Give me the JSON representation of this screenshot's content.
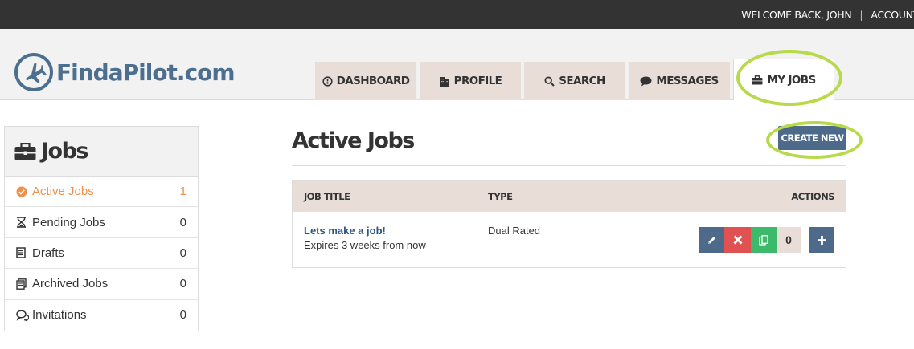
{
  "topbar": {
    "welcome": "WELCOME BACK, JOHN",
    "separator": "|",
    "account": "ACCOUNT"
  },
  "logo": {
    "text": "FindaPilot.com",
    "icon": "airplane-icon",
    "color": "#4d6f8f"
  },
  "nav": {
    "tabs": [
      {
        "label": "DASHBOARD",
        "icon": "dashboard-icon"
      },
      {
        "label": "PROFILE",
        "icon": "building-icon"
      },
      {
        "label": "SEARCH",
        "icon": "search-icon"
      },
      {
        "label": "MESSAGES",
        "icon": "chat-icon"
      },
      {
        "label": "MY JOBS",
        "icon": "briefcase-icon",
        "active": true
      }
    ]
  },
  "sidebar": {
    "title": "Jobs",
    "title_icon": "briefcase-icon",
    "items": [
      {
        "label": "Active Jobs",
        "count": "1",
        "icon": "check-circle-icon",
        "active": true
      },
      {
        "label": "Pending Jobs",
        "count": "0",
        "icon": "hourglass-icon"
      },
      {
        "label": "Drafts",
        "count": "0",
        "icon": "document-icon"
      },
      {
        "label": "Archived Jobs",
        "count": "0",
        "icon": "archive-icon"
      },
      {
        "label": "Invitations",
        "count": "0",
        "icon": "comments-icon"
      }
    ]
  },
  "main": {
    "title": "Active Jobs",
    "create_button": "CREATE NEW",
    "table": {
      "headers": {
        "title": "JOB TITLE",
        "type": "TYPE",
        "actions": "ACTIONS"
      },
      "rows": [
        {
          "title": "Lets make a job!",
          "expires": "Expires 3 weeks from now",
          "type": "Dual Rated",
          "count": "0",
          "actions": [
            "pencil-icon",
            "x-icon",
            "copy-icon",
            "plus-icon"
          ]
        }
      ]
    }
  },
  "colors": {
    "topbar": "#333333",
    "accent_blue": "#4d6a8a",
    "active_orange": "#f0904a",
    "tab_bg": "#e8ddd7",
    "danger": "#e05252",
    "success": "#3cb96a",
    "highlight": "#b8d94a"
  }
}
